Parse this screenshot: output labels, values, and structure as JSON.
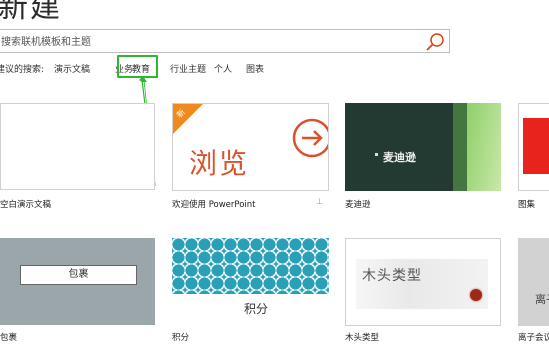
{
  "header": {
    "title": "新建"
  },
  "search": {
    "placeholder": "搜索联机模板和主题"
  },
  "suggestions": {
    "label": "建议的搜索:",
    "items": [
      "演示文稿",
      "业务",
      "教育",
      "行业",
      "主题",
      "个人",
      "图表"
    ],
    "highlighted": "教育"
  },
  "colors": {
    "highlight": "#2eb82e",
    "accent_orange": "#f08a1c",
    "browse_red": "#d9522b"
  },
  "templates": [
    {
      "caption": "空白演示文稿"
    },
    {
      "caption": "欢迎使用 PowerPoint",
      "ribbon": "新",
      "preview_text": "浏览",
      "icon": "arrow-right-circle-icon"
    },
    {
      "caption": "麦迪逊",
      "preview_text": "麦迪逊"
    },
    {
      "caption": "图集"
    },
    {
      "caption": "包裹",
      "preview_text": "包裹"
    },
    {
      "caption": "积分",
      "preview_text": "积分"
    },
    {
      "caption": "木头类型",
      "preview_text": "木头类型"
    },
    {
      "caption": "离子会议室",
      "preview_text": "离子"
    }
  ],
  "pin": {
    "icon": "pin-icon"
  }
}
